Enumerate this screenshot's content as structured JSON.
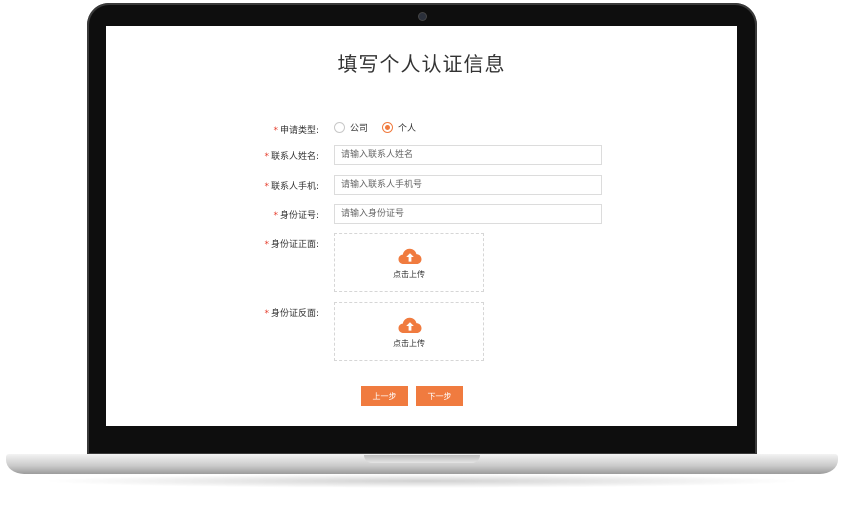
{
  "form": {
    "title": "填写个人认证信息",
    "type_label": "申请类型:",
    "type_options": [
      {
        "label": "公司",
        "checked": false
      },
      {
        "label": "个人",
        "checked": true
      }
    ],
    "name_label": "联系人姓名:",
    "name_placeholder": "请输入联系人姓名",
    "phone_label": "联系人手机:",
    "phone_placeholder": "请输入联系人手机号",
    "id_label": "身份证号:",
    "id_placeholder": "请输入身份证号",
    "front_label": "身份证正面:",
    "back_label": "身份证反面:",
    "upload_text": "点击上传",
    "prev_label": "上一步",
    "next_label": "下一步",
    "required_mark": "*"
  },
  "colors": {
    "accent": "#f07b3f",
    "required": "#e53c2b"
  },
  "icons": {
    "upload": "cloud-upload-icon",
    "camera": "webcam"
  }
}
